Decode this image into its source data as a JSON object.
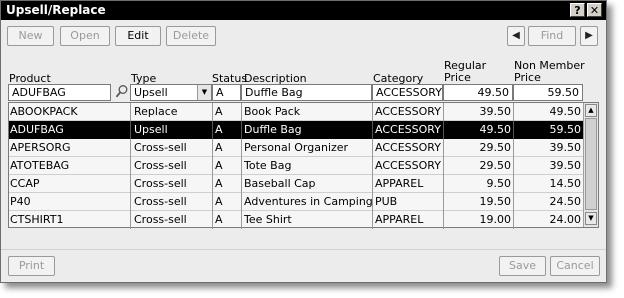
{
  "window": {
    "title": "Upsell/Replace",
    "help_label": "?",
    "close_label": "✕"
  },
  "toolbar": {
    "new_label": "New",
    "open_label": "Open",
    "edit_label": "Edit",
    "delete_label": "Delete",
    "find_label": "Find"
  },
  "columns": {
    "product": "Product",
    "type": "Type",
    "status": "Status",
    "description": "Description",
    "category": "Category",
    "regular_price_1": "Regular",
    "regular_price_2": "Price",
    "non_member_price_1": "Non Member",
    "non_member_price_2": "Price"
  },
  "filter": {
    "product": "ADUFBAG",
    "type": "Upsell",
    "status": "A",
    "description": "Duffle Bag",
    "category": "ACCESSORY",
    "regular_price": "49.50",
    "non_member_price": "59.50"
  },
  "rows": [
    {
      "product": "ABOOKPACK",
      "type": "Replace",
      "status": "A",
      "description": "Book Pack",
      "category": "ACCESSORY",
      "regular_price": "39.50",
      "non_member_price": "49.50"
    },
    {
      "product": "ADUFBAG",
      "type": "Upsell",
      "status": "A",
      "description": "Duffle Bag",
      "category": "ACCESSORY",
      "regular_price": "49.50",
      "non_member_price": "59.50"
    },
    {
      "product": "APERSORG",
      "type": "Cross-sell",
      "status": "A",
      "description": "Personal Organizer",
      "category": "ACCESSORY",
      "regular_price": "29.50",
      "non_member_price": "39.50"
    },
    {
      "product": "ATOTEBAG",
      "type": "Cross-sell",
      "status": "A",
      "description": "Tote Bag",
      "category": "ACCESSORY",
      "regular_price": "29.50",
      "non_member_price": "39.50"
    },
    {
      "product": "CCAP",
      "type": "Cross-sell",
      "status": "A",
      "description": "Baseball Cap",
      "category": "APPAREL",
      "regular_price": "9.50",
      "non_member_price": "14.50"
    },
    {
      "product": "P40",
      "type": "Cross-sell",
      "status": "A",
      "description": "Adventures in Camping",
      "category": "PUB",
      "regular_price": "19.50",
      "non_member_price": "24.50"
    },
    {
      "product": "CTSHIRT1",
      "type": "Cross-sell",
      "status": "A",
      "description": "Tee Shirt",
      "category": "APPAREL",
      "regular_price": "19.00",
      "non_member_price": "24.00"
    }
  ],
  "footer": {
    "print_label": "Print",
    "save_label": "Save",
    "cancel_label": "Cancel"
  }
}
